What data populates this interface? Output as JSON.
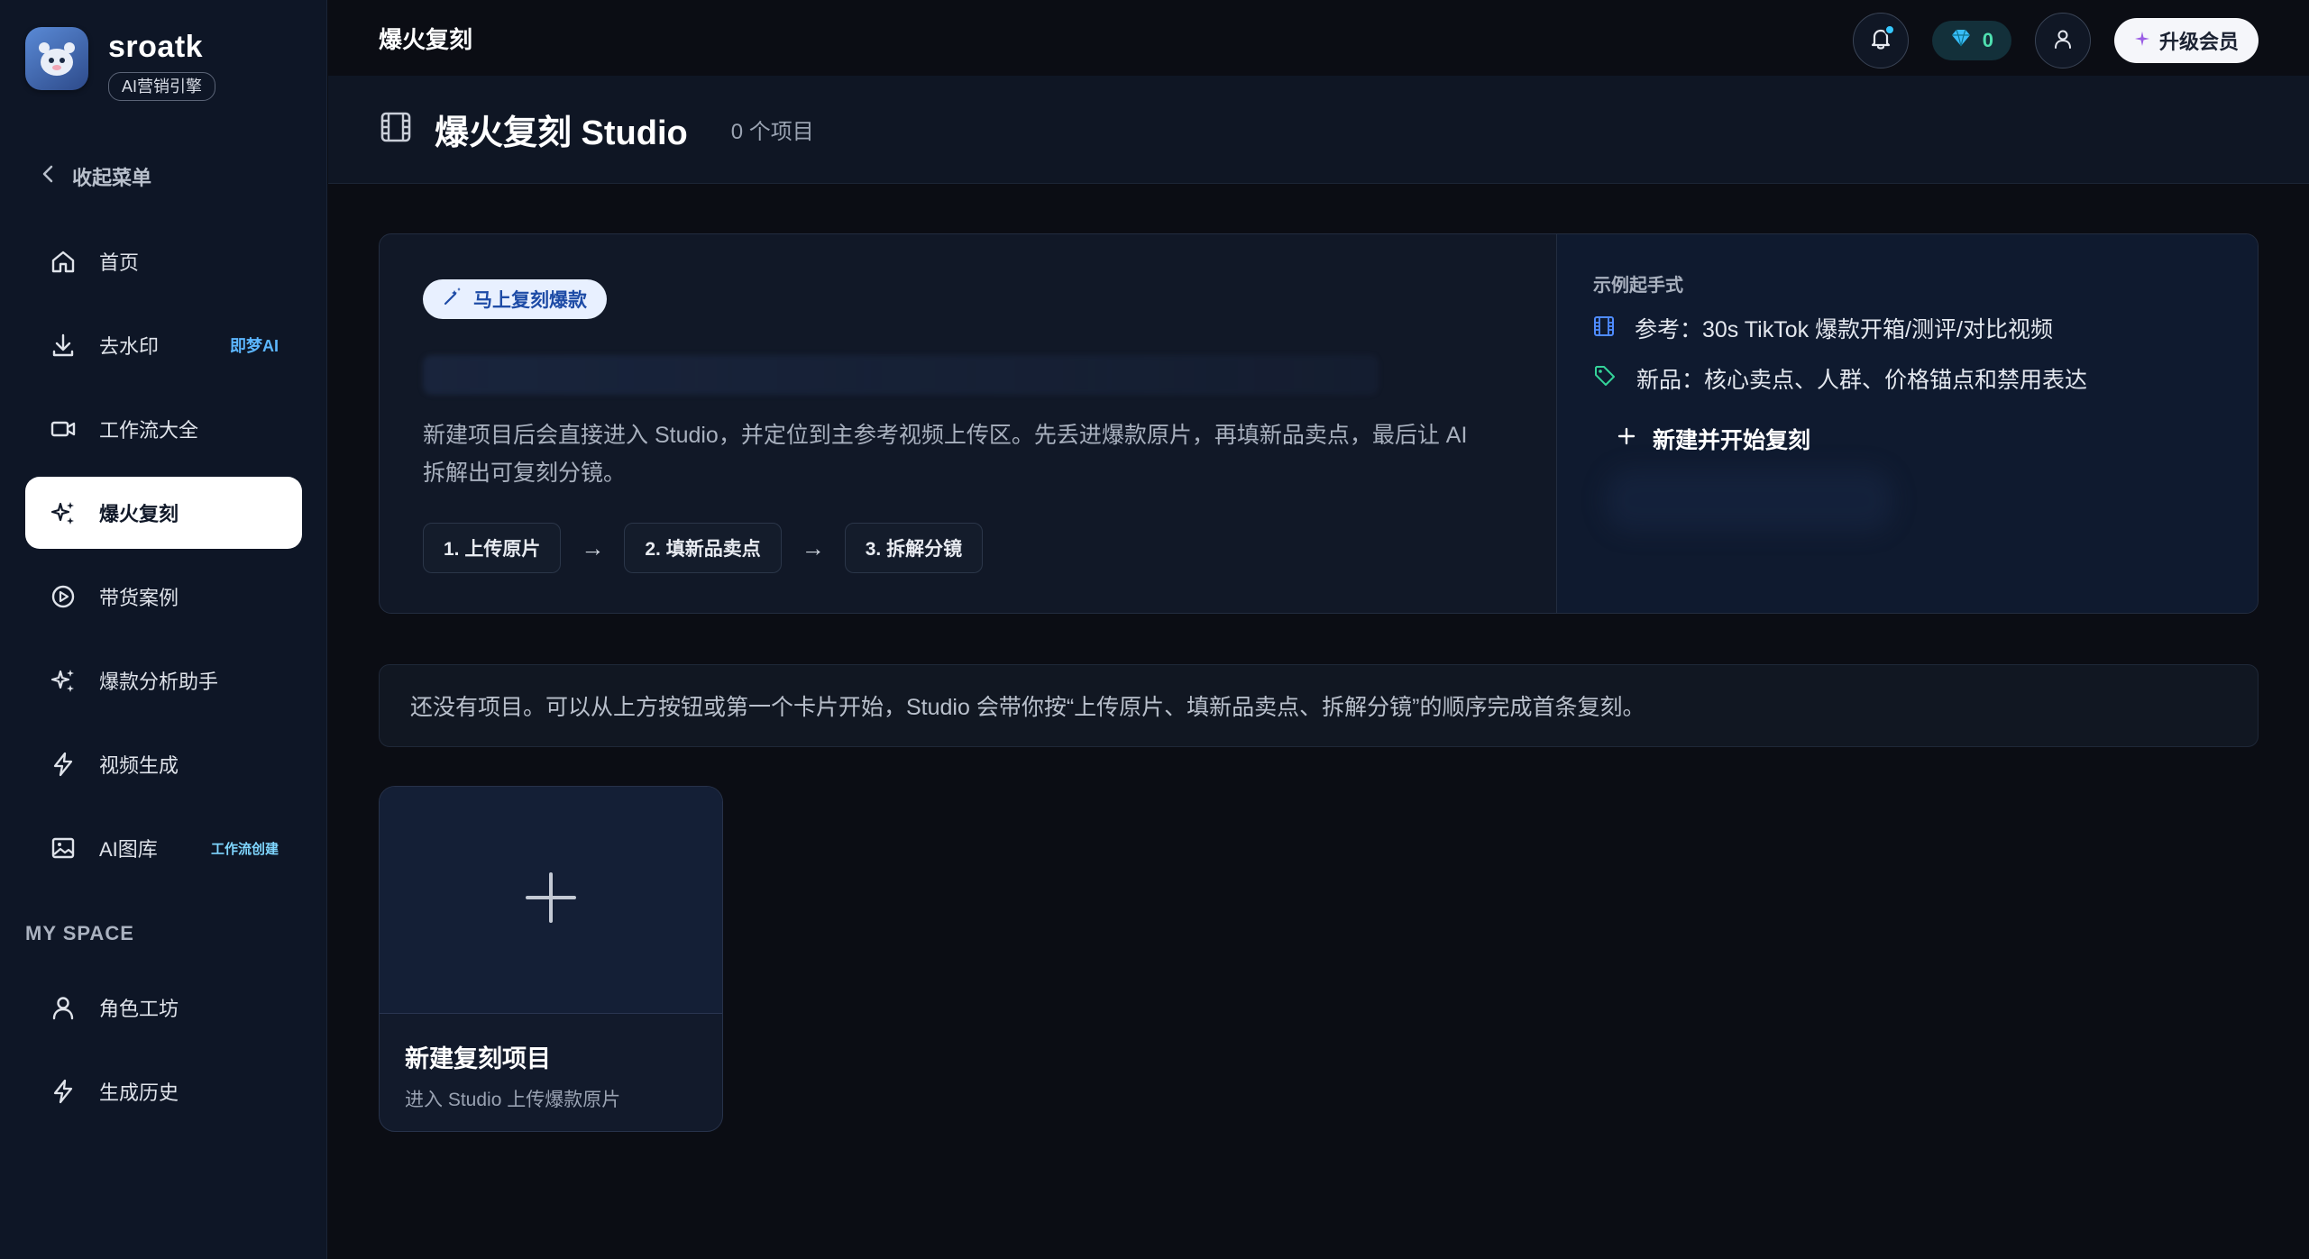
{
  "brand": {
    "name": "sroatk",
    "badge": "AI营销引擎"
  },
  "sidebar": {
    "collapse_label": "收起菜单",
    "items": [
      {
        "label": "首页",
        "icon": "home-icon"
      },
      {
        "label": "去水印",
        "icon": "download-icon",
        "tag": "即梦AI"
      },
      {
        "label": "工作流大全",
        "icon": "video-camera-icon"
      },
      {
        "label": "爆火复刻",
        "icon": "sparkles-icon",
        "active": true
      },
      {
        "label": "带货案例",
        "icon": "play-circle-icon"
      },
      {
        "label": "爆款分析助手",
        "icon": "sparkles-icon"
      },
      {
        "label": "视频生成",
        "icon": "lightning-icon"
      },
      {
        "label": "AI图库",
        "icon": "image-icon",
        "tag": "工作流创建"
      }
    ],
    "section_title": "MY SPACE",
    "space_items": [
      {
        "label": "角色工坊",
        "icon": "user-icon"
      },
      {
        "label": "生成历史",
        "icon": "lightning-icon"
      }
    ]
  },
  "topbar": {
    "title": "爆火复刻",
    "gems": "0",
    "upgrade_label": "升级会员"
  },
  "page": {
    "title": "爆火复刻 Studio",
    "count": "0 个项目"
  },
  "hero": {
    "chip": "马上复刻爆款",
    "description": "新建项目后会直接进入 Studio，并定位到主参考视频上传区。先丢进爆款原片，再填新品卖点，最后让 AI 拆解出可复刻分镜。",
    "steps": [
      "1. 上传原片",
      "2. 填新品卖点",
      "3. 拆解分镜"
    ],
    "example_title": "示例起手式",
    "example_ref": "参考：30s TikTok 爆款开箱/测评/对比视频",
    "example_new": "新品：核心卖点、人群、价格锚点和禁用表达",
    "new_start": "新建并开始复刻"
  },
  "notice": "还没有项目。可以从上方按钮或第一个卡片开始，Studio 会带你按“上传原片、填新品卖点、拆解分镜”的顺序完成首条复刻。",
  "new_card": {
    "title": "新建复刻项目",
    "subtitle": "进入 Studio 上传爆款原片"
  },
  "colors": {
    "accent": "#5cb6ff",
    "background": "#0b0d14",
    "sidebar": "#0e1626",
    "gem": "#4fe0b0"
  }
}
